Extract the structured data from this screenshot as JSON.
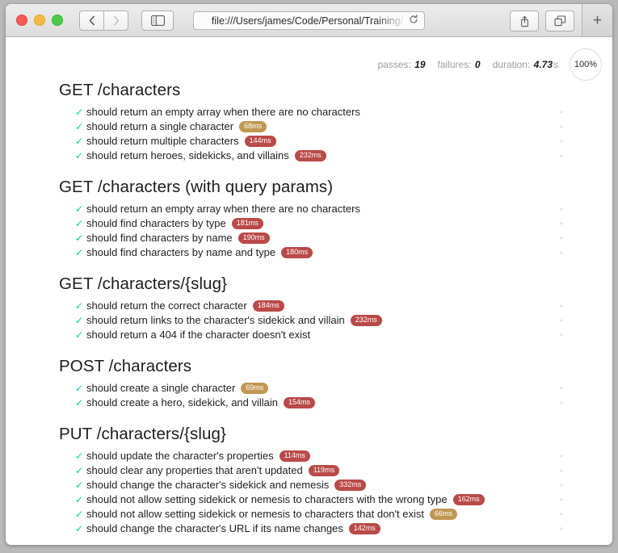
{
  "browser": {
    "url": "file:///Users/james/Code/Personal/Training/",
    "traffic_lights": [
      "close-red",
      "minimize-yellow",
      "zoom-green"
    ],
    "back_label": "‹",
    "forward_label": "›",
    "reload_label": "↻",
    "newtab_label": "+"
  },
  "stats": {
    "passes_label": "passes:",
    "passes_value": "19",
    "failures_label": "failures:",
    "failures_value": "0",
    "duration_label": "duration:",
    "duration_value": "4.73",
    "duration_unit": "s",
    "progress": "100%"
  },
  "colors": {
    "pass_check": "#01d1b2",
    "slow_badge": "#b94a48",
    "medium_badge": "#c09853",
    "heading": "#1d1d1d",
    "stat_label": "#9c9c9c"
  },
  "icons": {
    "check": "✓",
    "replay": "▸"
  },
  "suites": [
    {
      "title": "GET /characters",
      "tests": [
        {
          "name": "should return an empty array when there are no characters",
          "duration": null,
          "speed": null
        },
        {
          "name": "should return a single character",
          "duration": "68ms",
          "speed": "medium"
        },
        {
          "name": "should return multiple characters",
          "duration": "144ms",
          "speed": "slow"
        },
        {
          "name": "should return heroes, sidekicks, and villains",
          "duration": "232ms",
          "speed": "slow"
        }
      ]
    },
    {
      "title": "GET /characters (with query params)",
      "tests": [
        {
          "name": "should return an empty array when there are no characters",
          "duration": null,
          "speed": null
        },
        {
          "name": "should find characters by type",
          "duration": "181ms",
          "speed": "slow"
        },
        {
          "name": "should find characters by name",
          "duration": "190ms",
          "speed": "slow"
        },
        {
          "name": "should find characters by name and type",
          "duration": "180ms",
          "speed": "slow"
        }
      ]
    },
    {
      "title": "GET /characters/{slug}",
      "tests": [
        {
          "name": "should return the correct character",
          "duration": "184ms",
          "speed": "slow"
        },
        {
          "name": "should return links to the character's sidekick and villain",
          "duration": "232ms",
          "speed": "slow"
        },
        {
          "name": "should return a 404 if the character doesn't exist",
          "duration": null,
          "speed": null
        }
      ]
    },
    {
      "title": "POST /characters",
      "tests": [
        {
          "name": "should create a single character",
          "duration": "69ms",
          "speed": "medium"
        },
        {
          "name": "should create a hero, sidekick, and villain",
          "duration": "154ms",
          "speed": "slow"
        }
      ]
    },
    {
      "title": "PUT /characters/{slug}",
      "tests": [
        {
          "name": "should update the character's properties",
          "duration": "114ms",
          "speed": "slow"
        },
        {
          "name": "should clear any properties that aren't updated",
          "duration": "119ms",
          "speed": "slow"
        },
        {
          "name": "should change the character's sidekick and nemesis",
          "duration": "332ms",
          "speed": "slow"
        },
        {
          "name": "should not allow setting sidekick or nemesis to characters with the wrong type",
          "duration": "162ms",
          "speed": "slow"
        },
        {
          "name": "should not allow setting sidekick or nemesis to characters that don't exist",
          "duration": "66ms",
          "speed": "medium"
        },
        {
          "name": "should change the character's URL if its name changes",
          "duration": "142ms",
          "speed": "slow"
        }
      ]
    }
  ]
}
